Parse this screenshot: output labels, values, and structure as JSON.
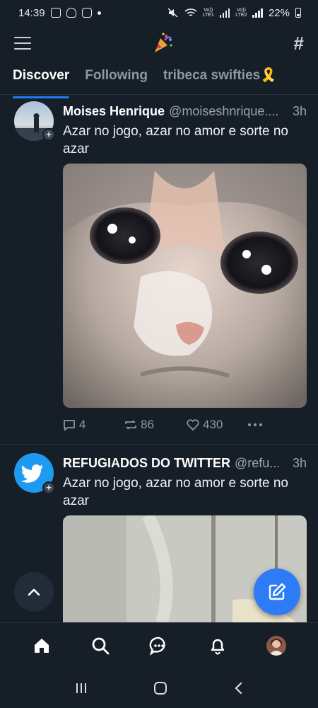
{
  "status_bar": {
    "time": "14:39",
    "battery": "22%",
    "lte1": "Vo)) LTE1",
    "lte2": "Vo)) LTE2"
  },
  "header": {
    "logo_icon": "party-popper-icon",
    "menu_icon": "hamburger-icon",
    "feeds_icon": "hash-icon"
  },
  "tabs": [
    {
      "label": "Discover",
      "active": true
    },
    {
      "label": "Following",
      "active": false
    },
    {
      "label": "tribeca swifties🎗️",
      "active": false
    }
  ],
  "posts": [
    {
      "name": "Moises Henrique",
      "handle": "@moiseshnrique....",
      "time": "3h",
      "text": "Azar no jogo, azar no amor e sorte no azar",
      "media": "crying cat",
      "replies": "4",
      "reposts": "86",
      "likes": "430"
    },
    {
      "name": "REFUGIADOS DO TWITTER",
      "handle": "@refu...",
      "time": "3h",
      "text": "Azar no jogo, azar no amor e sorte no azar"
    }
  ],
  "colors": {
    "background": "#161e27",
    "accent": "#1d7cf0",
    "compose": "#2d7cf6"
  },
  "bottom_nav": [
    "home-icon",
    "search-icon",
    "chat-icon",
    "bell-icon",
    "profile-avatar"
  ]
}
